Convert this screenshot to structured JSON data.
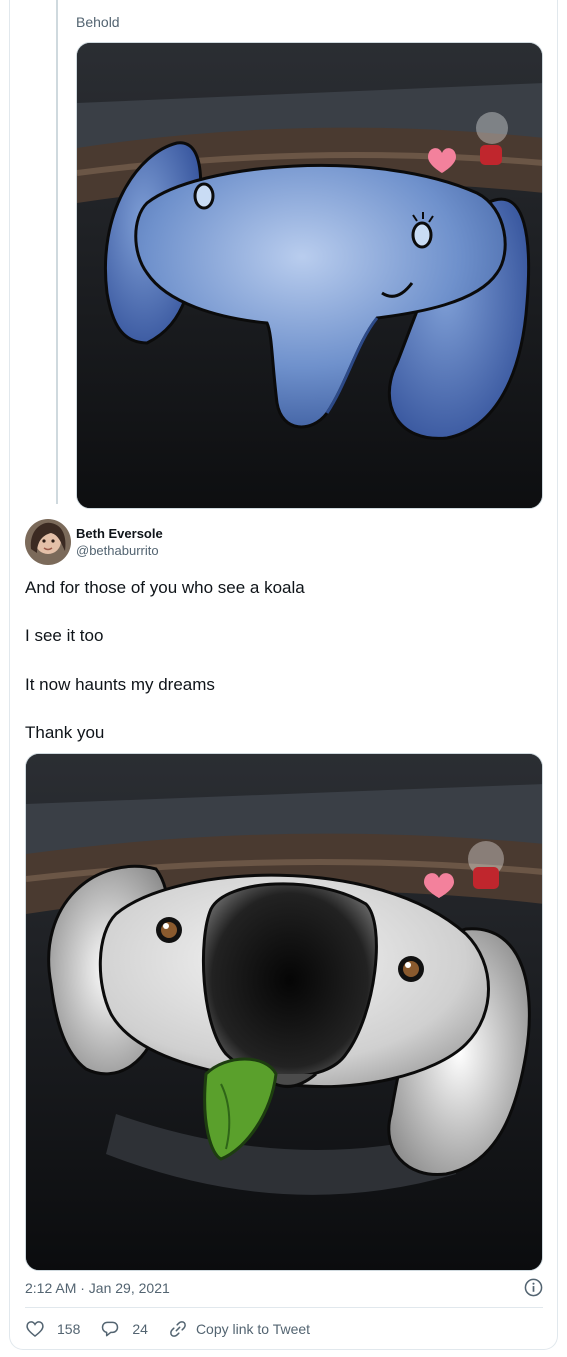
{
  "quoted_tweet": {
    "text": "Behold",
    "image": {
      "subject": "blue-elephant-steering-wheel-art"
    }
  },
  "tweet": {
    "author": {
      "display_name": "Beth Eversole",
      "handle": "@bethaburrito"
    },
    "lines": [
      "And for those of you who see a koala",
      "I see it too",
      "It now haunts my dreams",
      "Thank you"
    ],
    "image": {
      "subject": "koala-steering-wheel-art"
    },
    "timestamp": "2:12 AM · Jan 29, 2021",
    "likes": "158",
    "replies": "24",
    "copy_link_label": "Copy link to Tweet"
  },
  "colors": {
    "text_primary": "#0f1419",
    "text_secondary": "#536471",
    "border": "#e1e8ed",
    "elephant_blue": "#5b7fc0",
    "koala_gray": "#d8d8d8",
    "heart_pink": "#f3819c"
  },
  "icons": [
    "heart-icon",
    "reply-icon",
    "link-icon",
    "info-icon"
  ]
}
